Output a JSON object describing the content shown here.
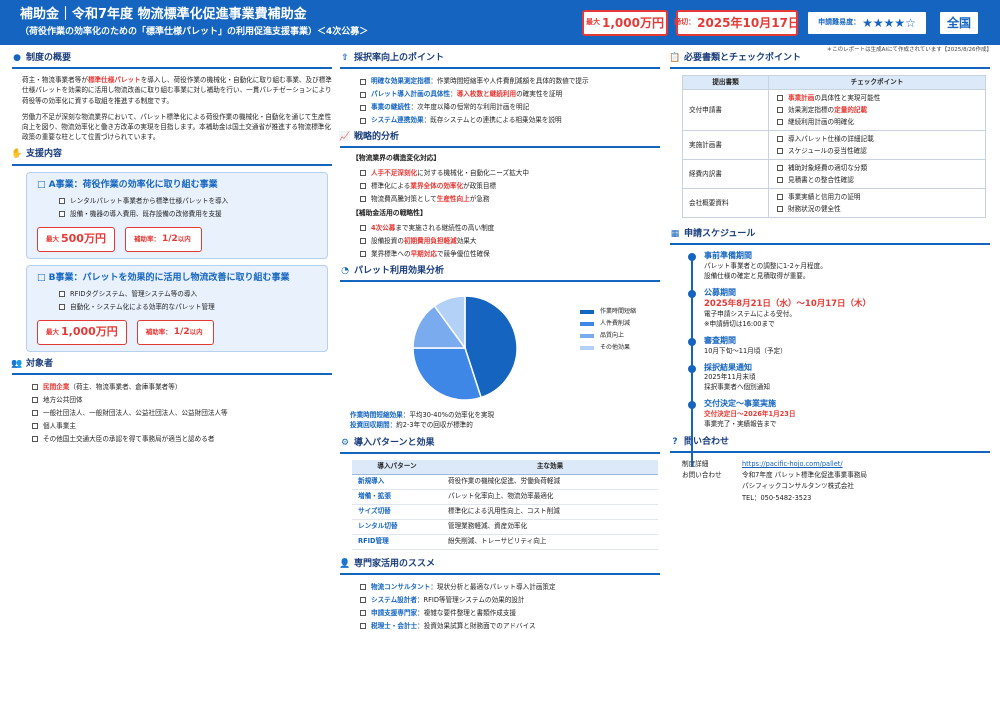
{
  "header": {
    "title": "補助金｜令和7年度 物流標準化促進事業費補助金",
    "subtitle": "（荷役作業の効率化のための「標準仕様パレット」の利用促進支援事業）＜4次公募＞",
    "max_prefix": "最大",
    "max_amount": "1,000万円",
    "deadline_prefix": "締切：",
    "deadline_date": "2025年10月17日",
    "difficulty_label": "申請難易度：",
    "difficulty_stars": "★★★★☆",
    "scope": "全国"
  },
  "note": "＊このレポートは生成AIにて作成されています【2025/8/26作成】",
  "overview": {
    "title": "制度の概要",
    "p1_a": "荷主・物流事業者等が",
    "p1_hl": "標準仕様パレット",
    "p1_b": "を導入し、荷役作業の機械化・自動化に取り組む事業、及び標準仕様パレットを効果的に活用し物流改善に取り組む事業に対し補助を行い、一貫パレチゼーションにより荷役等の効率化に資する取組を推進する制度です。",
    "p2": "労働力不足が深刻な物流業界において、パレット標準化による荷役作業の機械化・自動化を通じて生産性向上を図り、物流効率化と働き方改革の実現を目指します。本補助金は国土交通省が推進する物流標準化政策の重要な柱として位置づけられています。"
  },
  "support": {
    "title": "支援内容",
    "a": {
      "title": "□ A事業：荷役作業の効率化に取り組む事業",
      "items": [
        "レンタルパレット事業者から標準仕様パレットを導入",
        "設備・機器の導入費用、既存設備の改修費用を支援"
      ],
      "max_prefix": "最大",
      "max_value": "500万円",
      "rate_label": "補助率：",
      "rate_value": "1/2",
      "rate_suffix": "以内"
    },
    "b": {
      "title": "□ B事業：パレットを効果的に活用し物流改善に取り組む事業",
      "items": [
        "RFIDタグシステム、管理システム等の導入",
        "自動化・システム化による効率的なパレット管理"
      ],
      "max_prefix": "最大",
      "max_value": "1,000万円",
      "rate_label": "補助率：",
      "rate_value": "1/2",
      "rate_suffix": "以内"
    }
  },
  "targets": {
    "title": "対象者",
    "item1_hl": "民間企業",
    "item1_rest": "（荷主、物流事業者、倉庫事業者等）",
    "items": [
      "地方公共団体",
      "一般社団法人、一般財団法人、公益社団法人、公益財団法人等",
      "個人事業主",
      "その他国土交通大臣の承認を得て事務局が適当と認める者"
    ]
  },
  "points": {
    "title": "採択率向上のポイント",
    "items": [
      {
        "hl": "明確な効果測定指標",
        "rest": "：作業時間短縮率や人件費削減額を具体的数値で提示"
      },
      {
        "hl": "パレット導入計画の具体性",
        "rest": "：",
        "hl2": "導入枚数と継続利用",
        "rest2": "の確実性を証明"
      },
      {
        "hl": "事業の継続性",
        "rest": "：次年度以降の恒常的な利用計画を明記"
      },
      {
        "hl": "システム連携効果",
        "rest": "：既存システムとの連携による相乗効果を説明"
      }
    ]
  },
  "strategy": {
    "title": "戦略的分析",
    "sub1": "【物流業界の構造変化対応】",
    "items1": [
      {
        "hl": "人手不足深刻化",
        "rest": "に対する機械化・自動化ニーズ拡大中"
      },
      {
        "pre": "標準化による",
        "hl": "業界全体の効率化",
        "rest": "が政策目標"
      },
      {
        "pre": "物流費高騰対策として",
        "hl": "生産性向上",
        "rest": "が急務"
      }
    ],
    "sub2": "【補助金活用の戦略性】",
    "items2": [
      {
        "hl": "4次公募",
        "rest": "まで実施される継続性の高い制度"
      },
      {
        "pre": "設備投資の",
        "hl": "初期費用負担軽減",
        "rest": "効果大"
      },
      {
        "pre": "業界標準への",
        "hl": "早期対応",
        "rest": "で競争優位性確保"
      }
    ]
  },
  "pallet_effect": {
    "title": "パレット利用効果分析",
    "caption1_label": "作業時間短縮効果",
    "caption1_text": "：平均30-40%の効率化を実現",
    "caption2_label": "投資回収期間",
    "caption2_text": "：約2-3年での回収が標準的"
  },
  "chart_data": {
    "type": "pie",
    "categories": [
      "作業時間短縮",
      "人件費削減",
      "品質向上",
      "その他効果"
    ],
    "values": [
      45,
      30,
      15,
      10
    ],
    "colors": [
      "#1565c0",
      "#3f87e6",
      "#79abee",
      "#b3d1f7"
    ],
    "legend": "right"
  },
  "patterns": {
    "title": "導入パターンと効果",
    "header_pattern": "導入パターン",
    "header_effect": "主な効果",
    "rows": [
      {
        "name": "新規導入",
        "effect": "荷役作業の機械化促進、労働負荷軽減"
      },
      {
        "name": "増備・拡張",
        "effect": "パレット化率向上、物流効率最適化"
      },
      {
        "name": "サイズ切替",
        "effect": "標準化による汎用性向上、コスト削減"
      },
      {
        "name": "レンタル切替",
        "effect": "管理業務軽減、資産効率化"
      },
      {
        "name": "RFID管理",
        "effect": "紛失削減、トレーサビリティ向上"
      }
    ]
  },
  "experts": {
    "title": "専門家活用のススメ",
    "items": [
      {
        "hl": "物流コンサルタント",
        "rest": "：現状分析と最適なパレット導入計画策定"
      },
      {
        "hl": "システム設計者",
        "rest": "：RFID等管理システムの効果的設計"
      },
      {
        "hl": "申請支援専門家",
        "rest": "：複雑な要件整理と書類作成支援"
      },
      {
        "hl": "税理士・会計士",
        "rest": "：投資効果試算と財務面でのアドバイス"
      }
    ]
  },
  "documents": {
    "title": "必要書類とチェックポイント",
    "header_doc": "提出書類",
    "header_check": "チェックポイント",
    "rows": [
      {
        "name": "交付申請書",
        "checks": [
          {
            "hl": "事業計画",
            "rest": "の具体性と実現可能性"
          },
          {
            "pre": "効果測定指標の",
            "hl": "定量的記載",
            "rest": ""
          },
          {
            "rest": "継続利用計画の明確化"
          }
        ]
      },
      {
        "name": "実施計画書",
        "checks": [
          {
            "rest": "導入パレット仕様の詳細記載"
          },
          {
            "rest": "スケジュールの妥当性確認"
          }
        ]
      },
      {
        "name": "経費内訳書",
        "checks": [
          {
            "rest": "補助対象経費の適切な分類"
          },
          {
            "rest": "見積書との整合性確認"
          }
        ]
      },
      {
        "name": "会社概要資料",
        "checks": [
          {
            "rest": "事業実績と信用力の証明"
          },
          {
            "rest": "財務状況の健全性"
          }
        ]
      }
    ]
  },
  "schedule": {
    "title": "申請スケジュール",
    "items": [
      {
        "title": "事前準備期間",
        "lines": [
          "パレット事業者との調整に1-2ヶ月程度。",
          "設備仕様の確定と見積取得が重要。"
        ]
      },
      {
        "title": "公募期間",
        "highlight": "2025年8月21日（水）～10月17日（木）",
        "lines": [
          "電子申請システムによる受付。",
          "※申請締切は16:00まで"
        ]
      },
      {
        "title": "審査期間",
        "lines": [
          "10月下旬～11月頃（予定）"
        ]
      },
      {
        "title": "採択結果通知",
        "lines": [
          "2025年11月末頃",
          "採択事業者へ個別通知"
        ]
      },
      {
        "title": "交付決定～事業実施",
        "red_line": "交付決定日～2026年1月23日",
        "lines": [
          "事業完了・実績報告まで"
        ]
      }
    ]
  },
  "contact": {
    "title": "問い合わせ",
    "url_label": "制度詳細",
    "url": "https://pacific-hojo.com/pallet/",
    "inq_label": "お問い合わせ",
    "org1": "令和7年度 パレット標準化促進事業事務局",
    "org2": "パシフィックコンサルタンツ株式会社",
    "tel": "TEL：050-5482-3523"
  }
}
